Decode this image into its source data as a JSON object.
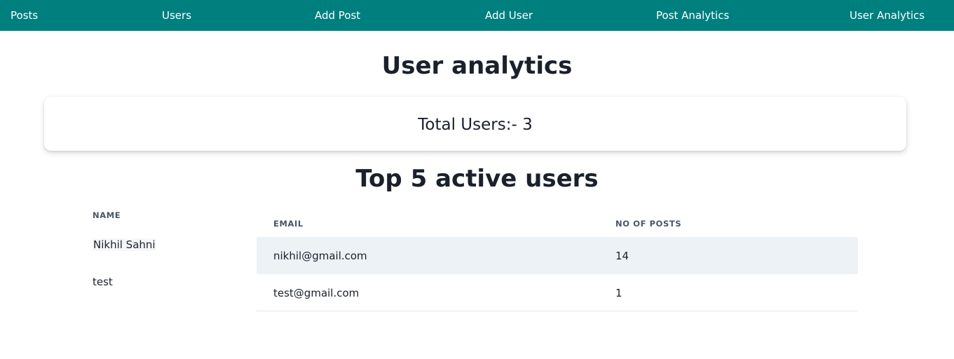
{
  "nav": {
    "items": [
      "Posts",
      "Users",
      "Add Post",
      "Add User",
      "Post Analytics",
      "User Analytics"
    ]
  },
  "page": {
    "title": "User analytics",
    "total_users_label": "Total Users:- 3",
    "top_users_title": "Top 5 active users"
  },
  "table": {
    "headers": {
      "name": "NAME",
      "email": "EMAIL",
      "posts": "NO OF POSTS"
    },
    "rows": [
      {
        "name": "Nikhil Sahni",
        "email": "nikhil@gmail.com",
        "posts": "14"
      },
      {
        "name": "test",
        "email": "test@gmail.com",
        "posts": "1"
      }
    ]
  },
  "colors": {
    "navbar": "#007f7f",
    "row_highlight": "#edf2f7",
    "heading": "#1a202c"
  }
}
